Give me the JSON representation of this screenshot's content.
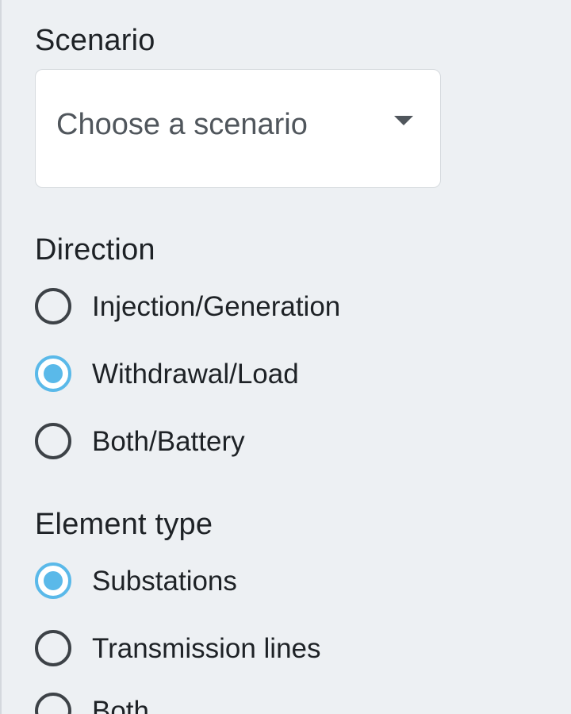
{
  "scenario": {
    "label": "Scenario",
    "placeholder": "Choose a scenario"
  },
  "direction": {
    "label": "Direction",
    "options": [
      {
        "label": "Injection/Generation",
        "checked": false
      },
      {
        "label": "Withdrawal/Load",
        "checked": true
      },
      {
        "label": "Both/Battery",
        "checked": false
      }
    ]
  },
  "element_type": {
    "label": "Element type",
    "options": [
      {
        "label": "Substations",
        "checked": true
      },
      {
        "label": "Transmission lines",
        "checked": false
      },
      {
        "label": "Both",
        "checked": false
      }
    ]
  },
  "colors": {
    "accent": "#5ab9e9",
    "background": "#edf0f3"
  }
}
